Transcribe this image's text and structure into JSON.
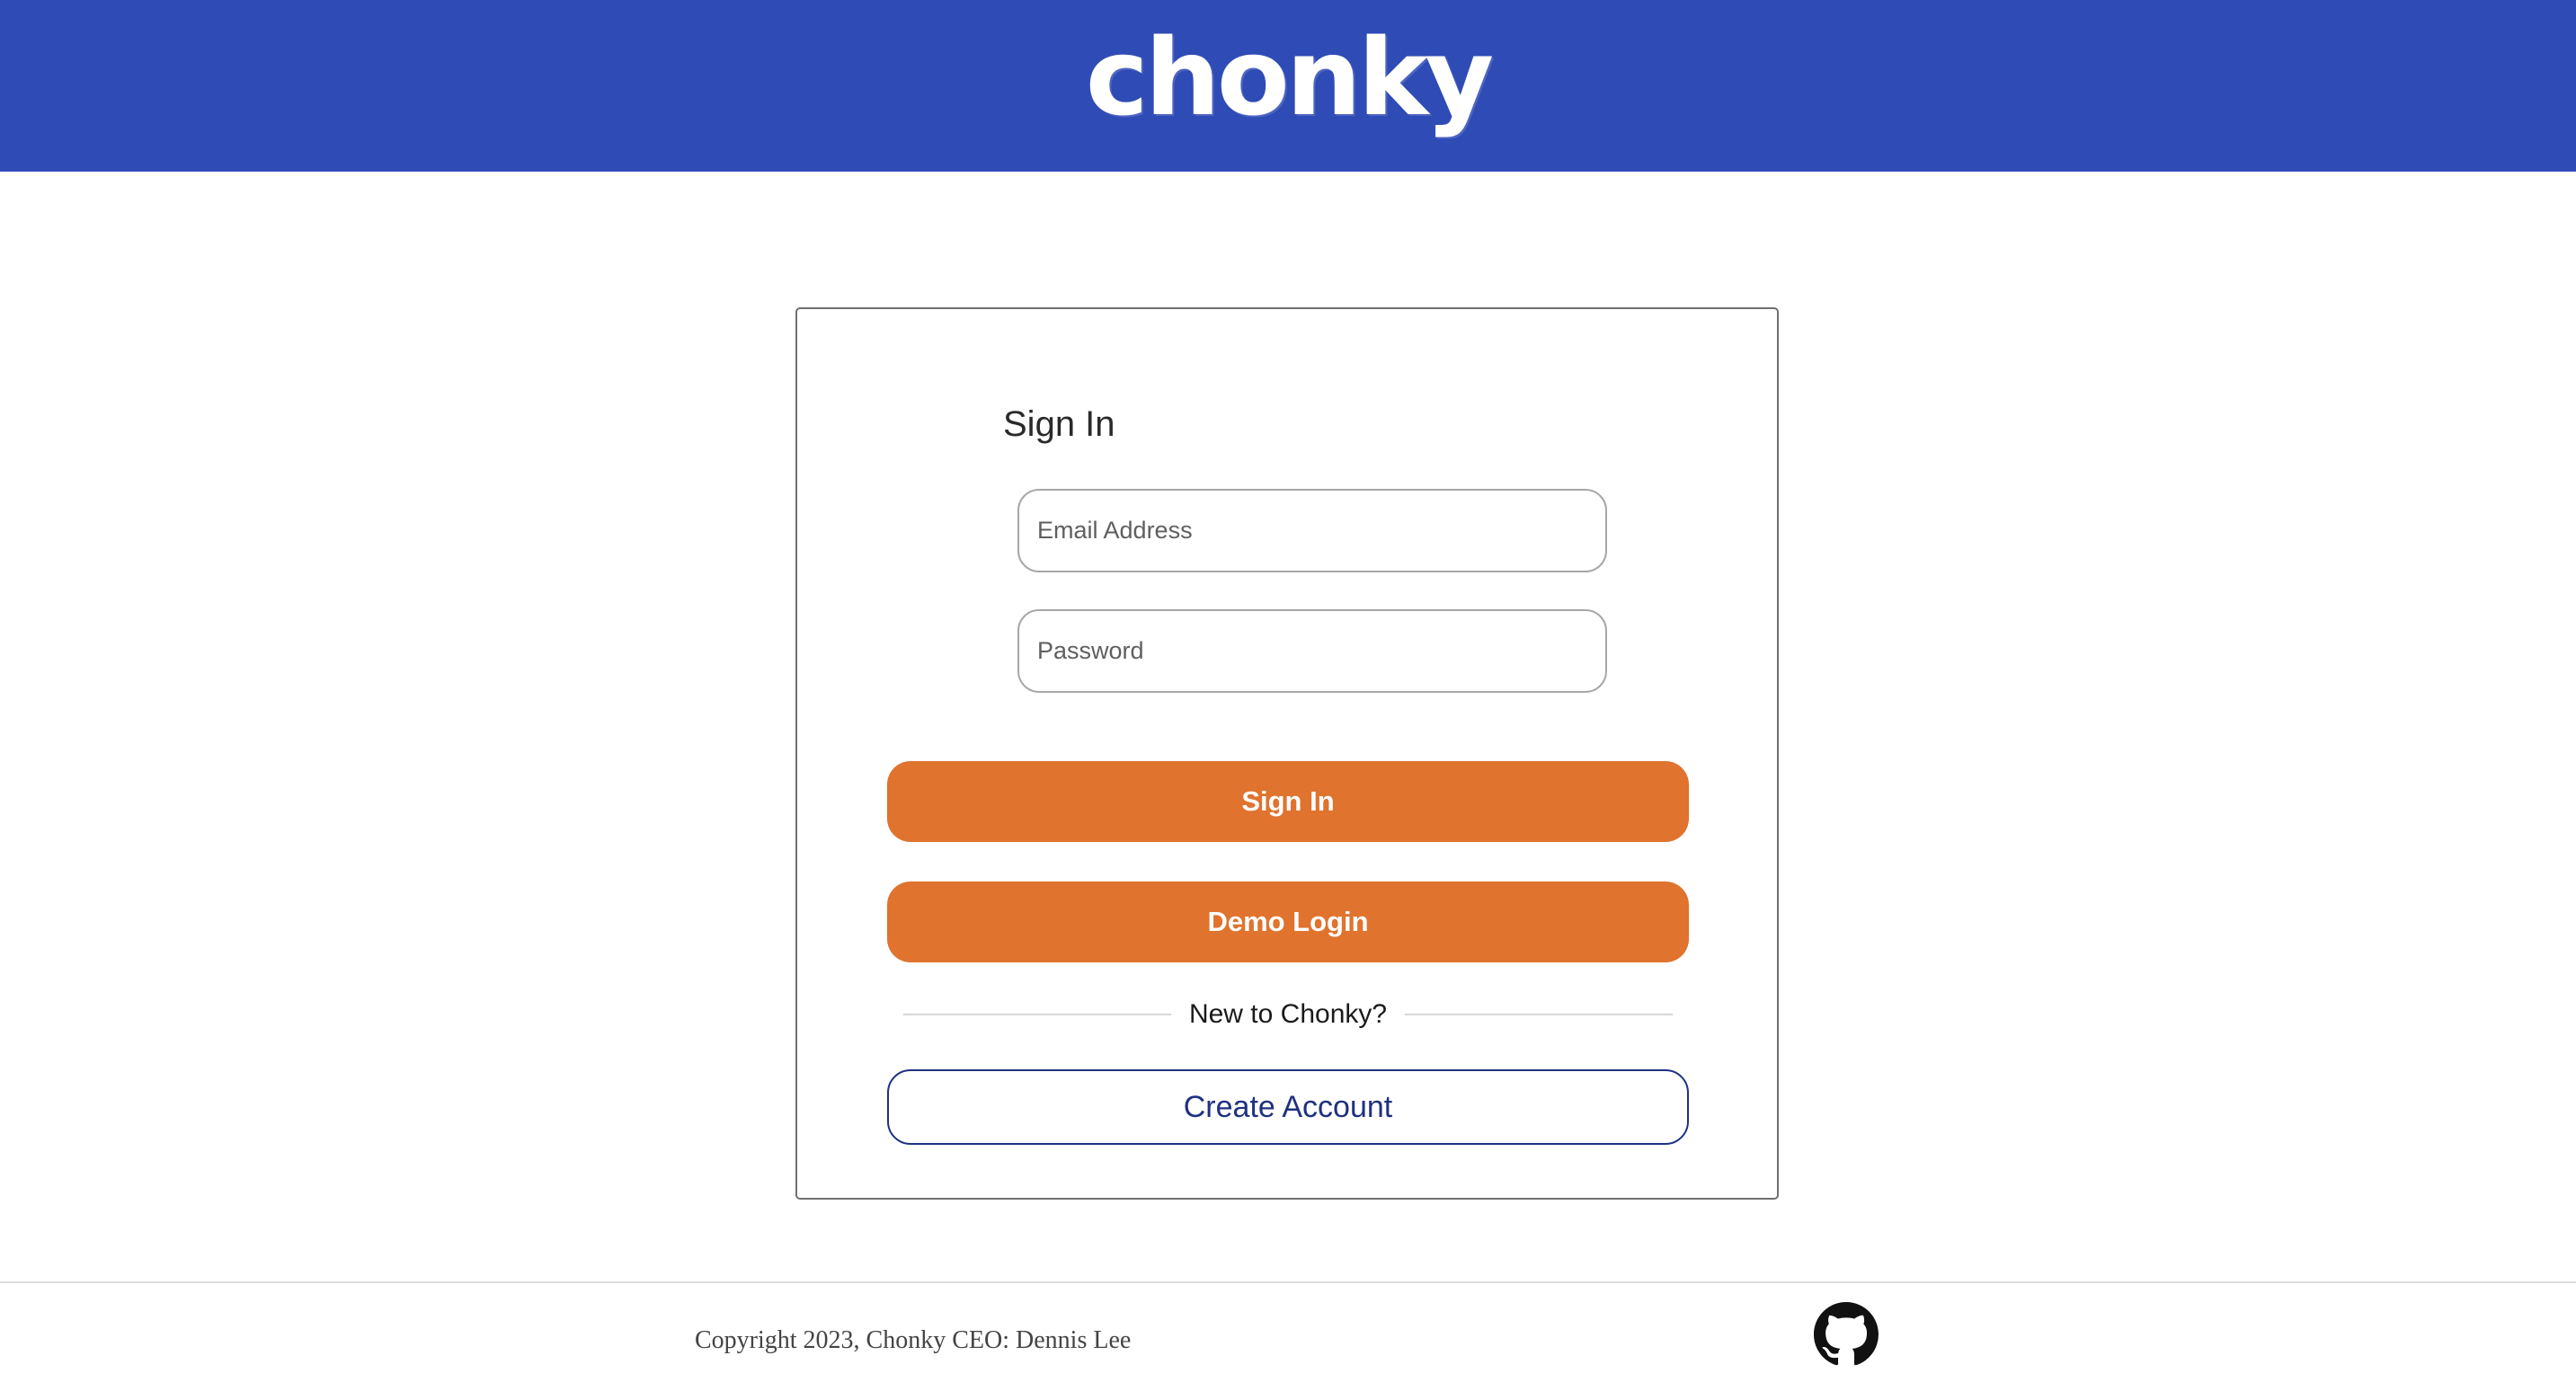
{
  "header": {
    "logo_text": "chonky",
    "background_color": "#2f4bb5"
  },
  "signin_form": {
    "title": "Sign In",
    "email_placeholder": "Email Address",
    "email_value": "",
    "password_placeholder": "Password",
    "password_value": "",
    "signin_button_label": "Sign In",
    "demo_button_label": "Demo Login",
    "divider_text": "New to Chonky?",
    "create_account_label": "Create Account",
    "primary_button_color": "#e0732e",
    "outline_button_color": "#1f3180"
  },
  "footer": {
    "copyright": "Copyright 2023, Chonky CEO: Dennis Lee",
    "github_icon": "github-icon"
  }
}
